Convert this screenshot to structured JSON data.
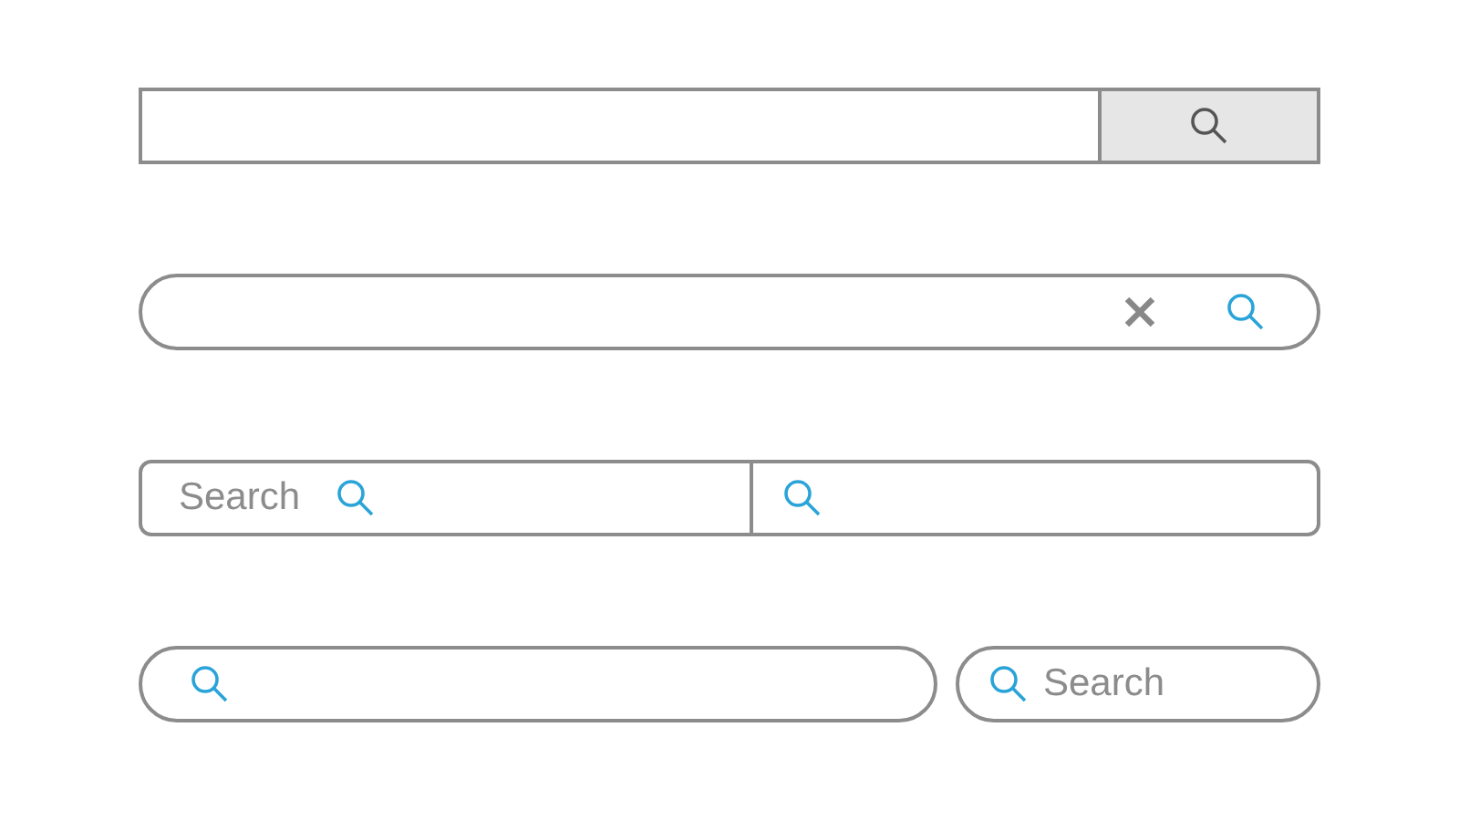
{
  "search_bars": [
    {
      "kind": "button-bar"
    },
    {
      "kind": "clear-bar"
    },
    {
      "kind": "split-bar",
      "placeholder": "Search"
    },
    {
      "kind": "pill-pair",
      "placeholder": "Search"
    }
  ]
}
